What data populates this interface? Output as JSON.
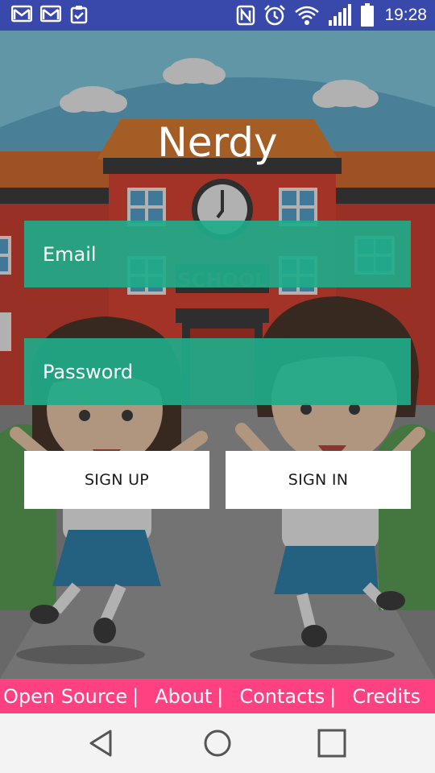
{
  "status_bar": {
    "time": "19:28",
    "left_icons": [
      "gmail-icon",
      "gmail-icon",
      "clipboard-check-icon"
    ],
    "right_icons": [
      "nfc-icon",
      "alarm-icon",
      "wifi-icon",
      "signal-icon",
      "battery-icon"
    ]
  },
  "background": {
    "sign_text": "SCHOOL"
  },
  "login": {
    "title": "Nerdy",
    "email_placeholder": "Email",
    "password_placeholder": "Password",
    "signup_label": "SIGN UP",
    "signin_label": "SIGN IN"
  },
  "footer": {
    "links": [
      "Open Source",
      "About",
      "Contacts",
      "Credits"
    ],
    "separator": "|"
  },
  "nav_bar": {
    "buttons": [
      "back-icon",
      "home-icon",
      "recents-icon"
    ]
  },
  "colors": {
    "status_bar": "#3949ab",
    "input_field": "#1fab89",
    "footer": "#ff4081",
    "button_bg": "#ffffff",
    "nav_bar": "#f3f3f3"
  }
}
